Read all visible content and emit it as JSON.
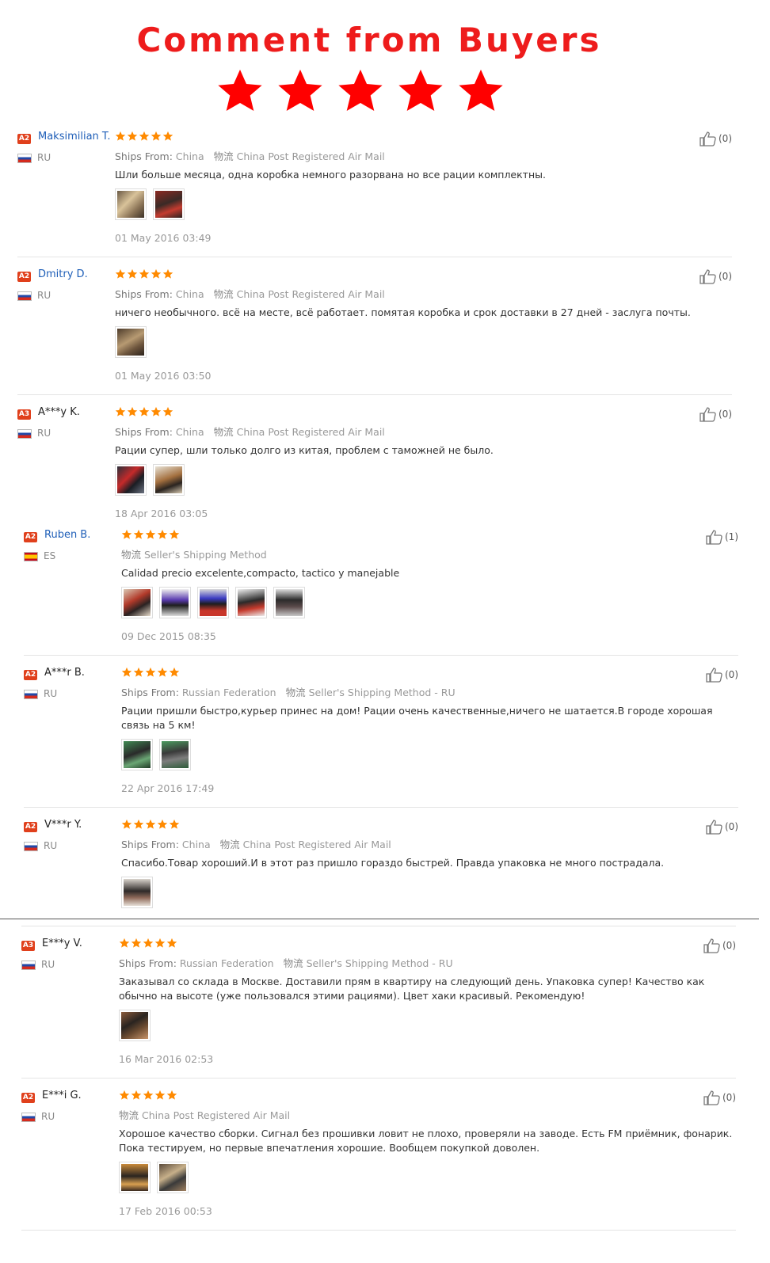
{
  "banner": {
    "title": "Comment from Buyers",
    "star_color": "#ff0000"
  },
  "colors": {
    "star": "#ff8a00",
    "name_link": "#1f5fb8",
    "badge": "#e0401c"
  },
  "reviews": [
    {
      "badge": "A2",
      "name": "Maksimilian T.",
      "country": "RU",
      "flag": "ru",
      "ship_from_label": "Ships From:",
      "ship_from": "China",
      "wuliu": "物流",
      "method": "China Post Registered Air Mail",
      "text": "Шли больше месяца, одна коробка немного разорвана но все рации комплектны.",
      "date": "01 May 2016 03:49",
      "likes": "(0)"
    },
    {
      "badge": "A2",
      "name": "Dmitry D.",
      "country": "RU",
      "flag": "ru",
      "ship_from_label": "Ships From:",
      "ship_from": "China",
      "wuliu": "物流",
      "method": "China Post Registered Air Mail",
      "text": "ничего необычного. всё на месте, всё работает. помятая коробка и срок доставки в 27 дней - заслуга почты.",
      "date": "01 May 2016 03:50",
      "likes": "(0)"
    },
    {
      "badge": "A3",
      "name": "A***y K.",
      "country": "RU",
      "flag": "ru",
      "ship_from_label": "Ships From:",
      "ship_from": "China",
      "wuliu": "物流",
      "method": "China Post Registered Air Mail",
      "text": "Рации супер, шли только долго из китая, проблем с таможней не было.",
      "date": "18 Apr 2016 03:05",
      "likes": "(0)"
    },
    {
      "badge": "A2",
      "name": "Ruben B.",
      "country": "ES",
      "flag": "es",
      "wuliu": "物流",
      "method": "Seller's Shipping Method",
      "text": "Calidad precio excelente,compacto, tactico y manejable",
      "date": "09 Dec 2015 08:35",
      "likes": "(1)"
    },
    {
      "badge": "A2",
      "name": "A***r B.",
      "country": "RU",
      "flag": "ru",
      "ship_from_label": "Ships From:",
      "ship_from": "Russian Federation",
      "wuliu": "物流",
      "method": "Seller's Shipping Method - RU",
      "text": "Рации пришли быстро,курьер принес на дом! Рации очень качественные,ничего не шатается.В городе хорошая связь на 5 км!",
      "date": "22 Apr 2016 17:49",
      "likes": "(0)"
    },
    {
      "badge": "A2",
      "name": "V***r Y.",
      "country": "RU",
      "flag": "ru",
      "ship_from_label": "Ships From:",
      "ship_from": "China",
      "wuliu": "物流",
      "method": "China Post Registered Air Mail",
      "text": "Спасибо.Товар хороший.И в этот раз пришло гораздо быстрей. Правда упаковка не много пострадала.",
      "likes": "(0)"
    },
    {
      "badge": "A3",
      "name": "E***y V.",
      "country": "RU",
      "flag": "ru",
      "ship_from_label": "Ships From:",
      "ship_from": "Russian Federation",
      "wuliu": "物流",
      "method": "Seller's Shipping Method - RU",
      "text": "Заказывал со склада в Москве. Доставили прям в квартиру на следующий день. Упаковка супер! Качество как обычно на высоте (уже пользовался этими рациями). Цвет хаки красивый. Рекомендую!",
      "date": "16 Mar 2016 02:53",
      "likes": "(0)"
    },
    {
      "badge": "A2",
      "name": "E***i G.",
      "country": "RU",
      "flag": "ru",
      "wuliu": "物流",
      "method": "China Post Registered Air Mail",
      "text": "Хорошое качество сборки. Сигнал без прошивки ловит не плохо, проверяли на заводе. Есть FM приёмник, фонарик. Пока тестируем, но первые впечатления хорошие. Вообщем покупкой доволен.",
      "date": "17 Feb 2016 00:53",
      "likes": "(0)"
    }
  ]
}
